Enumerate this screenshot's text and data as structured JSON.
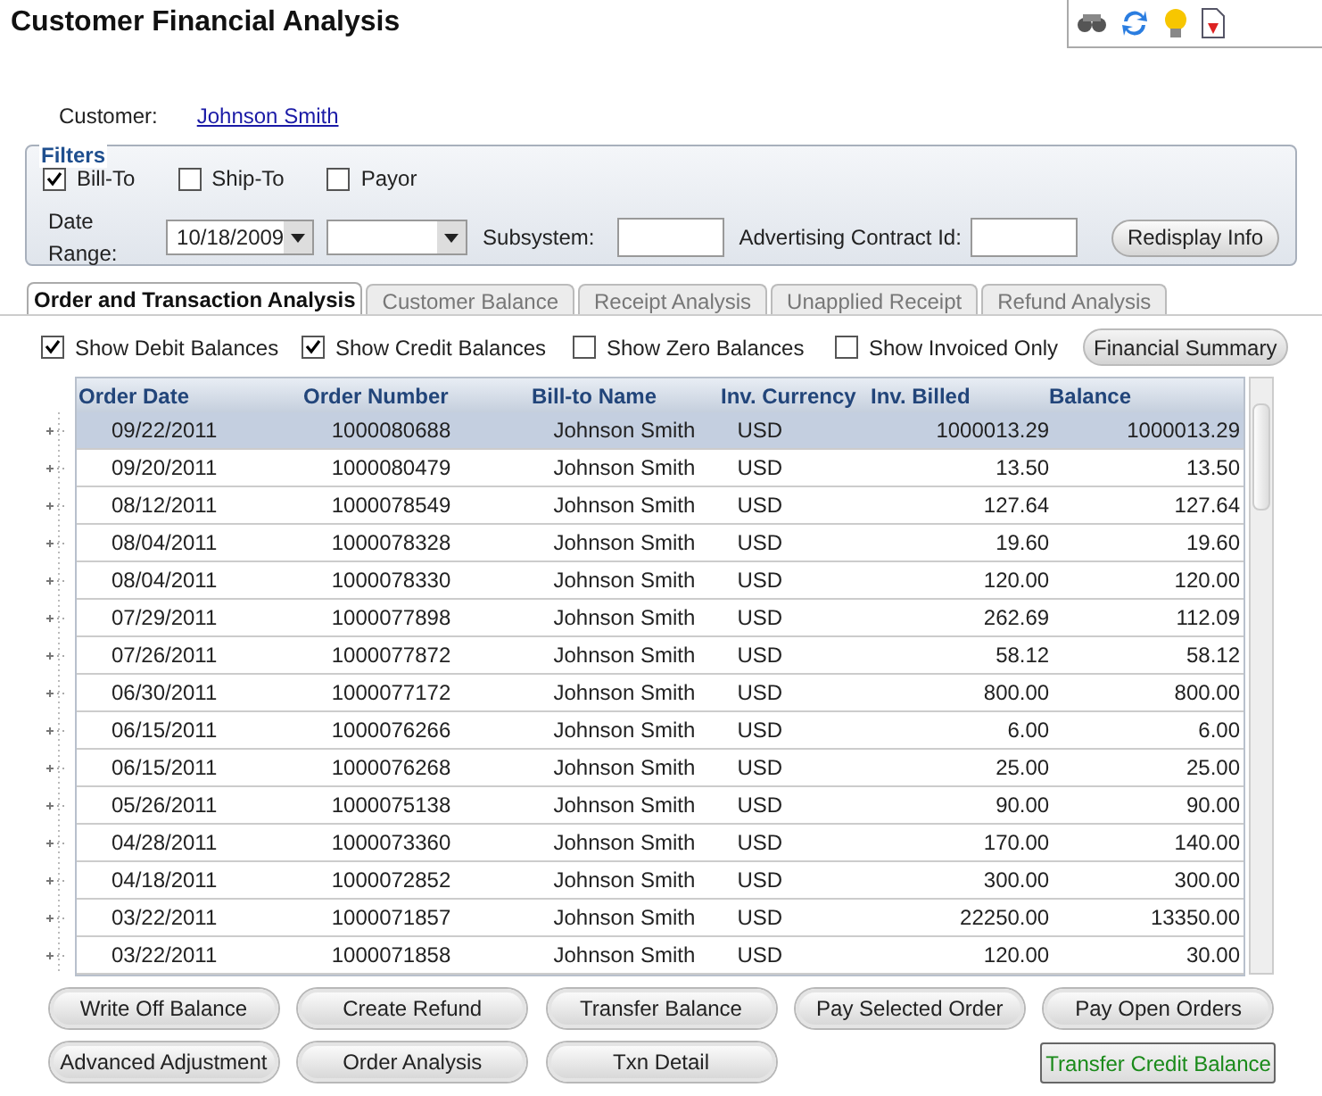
{
  "title": "Customer Financial Analysis",
  "customer": {
    "label": "Customer:",
    "value": "Johnson Smith"
  },
  "filters": {
    "legend": "Filters",
    "checks": [
      {
        "label": "Bill-To",
        "checked": true
      },
      {
        "label": "Ship-To",
        "checked": false
      },
      {
        "label": "Payor",
        "checked": false
      }
    ],
    "date_range_label": "Date Range:",
    "date_from": "10/18/2009",
    "subsystem_label": "Subsystem:",
    "contract_label": "Advertising Contract Id:",
    "redisplay": "Redisplay Info"
  },
  "tabs": [
    {
      "label": "Order and Transaction Analysis",
      "selected": true
    },
    {
      "label": "Customer Balance",
      "selected": false
    },
    {
      "label": "Receipt Analysis",
      "selected": false
    },
    {
      "label": "Unapplied Receipt",
      "selected": false
    },
    {
      "label": "Refund Analysis",
      "selected": false
    }
  ],
  "options": [
    {
      "label": "Show Debit Balances",
      "checked": true
    },
    {
      "label": "Show Credit Balances",
      "checked": true
    },
    {
      "label": "Show Zero Balances",
      "checked": false
    },
    {
      "label": "Show Invoiced Only",
      "checked": false
    }
  ],
  "summary_button": "Financial Summary",
  "table": {
    "columns": [
      "Order Date",
      "Order Number",
      "Bill-to Name",
      "Inv. Currency",
      "Inv. Billed",
      "Balance"
    ],
    "rows": [
      {
        "cells": [
          "09/22/2011",
          "1000080688",
          "Johnson Smith",
          "USD",
          "1000013.29",
          "1000013.29"
        ],
        "selected": true
      },
      {
        "cells": [
          "09/20/2011",
          "1000080479",
          "Johnson Smith",
          "USD",
          "13.50",
          "13.50"
        ],
        "selected": false
      },
      {
        "cells": [
          "08/12/2011",
          "1000078549",
          "Johnson Smith",
          "USD",
          "127.64",
          "127.64"
        ],
        "selected": false
      },
      {
        "cells": [
          "08/04/2011",
          "1000078328",
          "Johnson Smith",
          "USD",
          "19.60",
          "19.60"
        ],
        "selected": false
      },
      {
        "cells": [
          "08/04/2011",
          "1000078330",
          "Johnson Smith",
          "USD",
          "120.00",
          "120.00"
        ],
        "selected": false
      },
      {
        "cells": [
          "07/29/2011",
          "1000077898",
          "Johnson Smith",
          "USD",
          "262.69",
          "112.09"
        ],
        "selected": false
      },
      {
        "cells": [
          "07/26/2011",
          "1000077872",
          "Johnson Smith",
          "USD",
          "58.12",
          "58.12"
        ],
        "selected": false
      },
      {
        "cells": [
          "06/30/2011",
          "1000077172",
          "Johnson Smith",
          "USD",
          "800.00",
          "800.00"
        ],
        "selected": false
      },
      {
        "cells": [
          "06/15/2011",
          "1000076266",
          "Johnson Smith",
          "USD",
          "6.00",
          "6.00"
        ],
        "selected": false
      },
      {
        "cells": [
          "06/15/2011",
          "1000076268",
          "Johnson Smith",
          "USD",
          "25.00",
          "25.00"
        ],
        "selected": false
      },
      {
        "cells": [
          "05/26/2011",
          "1000075138",
          "Johnson Smith",
          "USD",
          "90.00",
          "90.00"
        ],
        "selected": false
      },
      {
        "cells": [
          "04/28/2011",
          "1000073360",
          "Johnson Smith",
          "USD",
          "170.00",
          "140.00"
        ],
        "selected": false
      },
      {
        "cells": [
          "04/18/2011",
          "1000072852",
          "Johnson Smith",
          "USD",
          "300.00",
          "300.00"
        ],
        "selected": false
      },
      {
        "cells": [
          "03/22/2011",
          "1000071857",
          "Johnson Smith",
          "USD",
          "22250.00",
          "13350.00"
        ],
        "selected": false
      },
      {
        "cells": [
          "03/22/2011",
          "1000071858",
          "Johnson Smith",
          "USD",
          "120.00",
          "30.00"
        ],
        "selected": false
      }
    ]
  },
  "buttons": [
    {
      "label": "Write Off Balance",
      "kind": "round"
    },
    {
      "label": "Create Refund",
      "kind": "round"
    },
    {
      "label": "Transfer Balance",
      "kind": "round"
    },
    {
      "label": "Pay Selected Order",
      "kind": "round"
    },
    {
      "label": "Pay Open Orders",
      "kind": "round"
    },
    {
      "label": "Advanced Adjustment",
      "kind": "round"
    },
    {
      "label": "Order Analysis",
      "kind": "round"
    },
    {
      "label": "Txn Detail",
      "kind": "round"
    },
    {
      "label": "Transfer Credit Balance",
      "kind": "default"
    }
  ]
}
